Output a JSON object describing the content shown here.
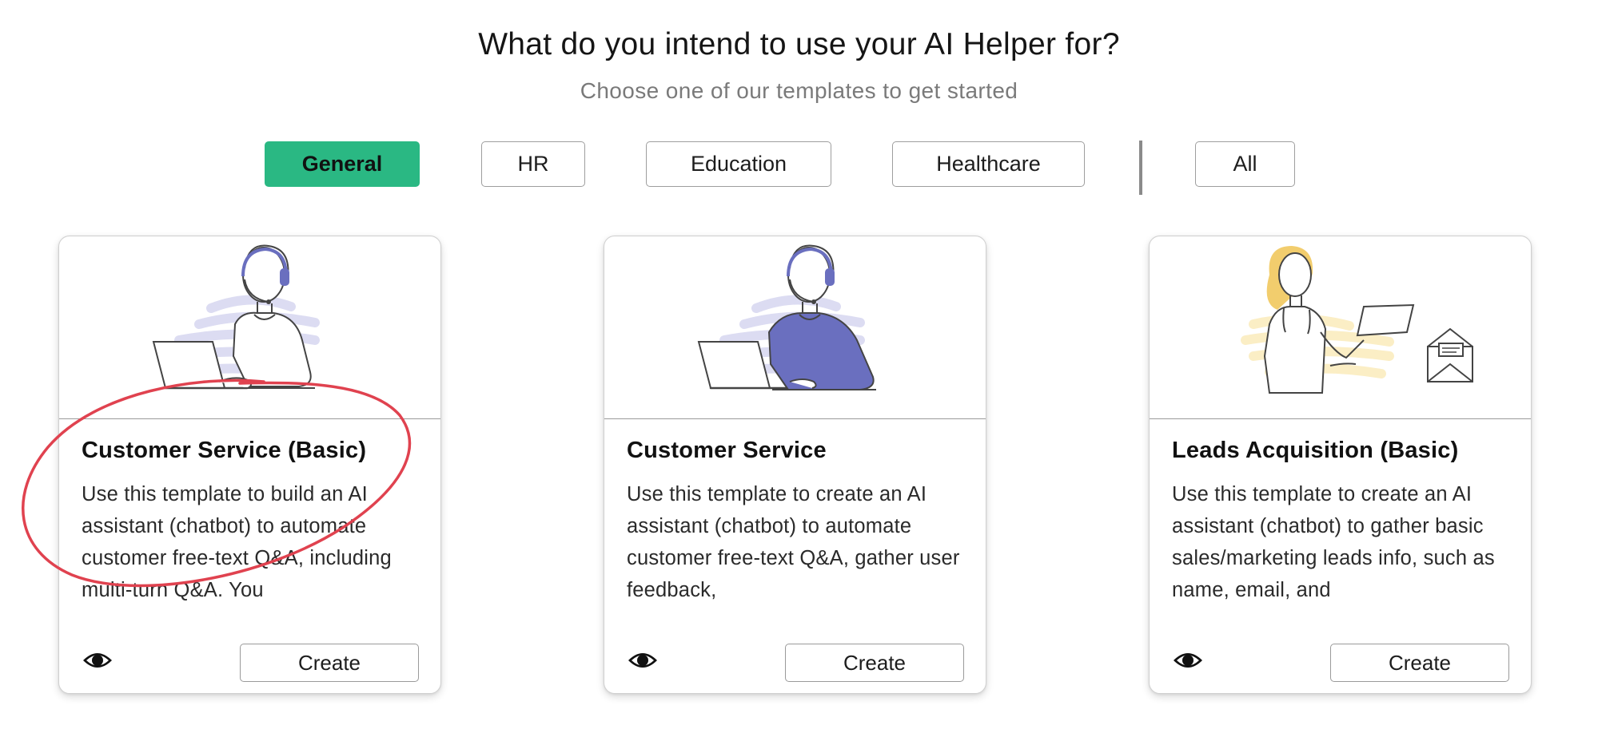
{
  "header": {
    "title": "What do you intend to use your AI Helper for?",
    "subtitle": "Choose one of our templates to get started"
  },
  "tabs": [
    {
      "label": "General",
      "active": true
    },
    {
      "label": "HR",
      "active": false
    },
    {
      "label": "Education",
      "active": false
    },
    {
      "label": "Healthcare",
      "active": false
    },
    {
      "label": "All",
      "active": false
    }
  ],
  "cards": [
    {
      "title": "Customer Service (Basic)",
      "description": "Use this template to build an AI assistant (chatbot) to automate customer free-text Q&A, including multi-turn Q&A. You",
      "illustration": "agent-with-headset-outline",
      "preview_icon": "eye-icon",
      "create_label": "Create"
    },
    {
      "title": "Customer Service",
      "description": "Use this template to create an AI assistant (chatbot) to automate customer free-text Q&A, gather user feedback,",
      "illustration": "agent-with-headset-purple-shirt",
      "preview_icon": "eye-icon",
      "create_label": "Create"
    },
    {
      "title": "Leads Acquisition (Basic)",
      "description": "Use this template to create an AI assistant (chatbot) to gather basic sales/marketing leads info, such as name, email, and",
      "illustration": "woman-with-tablet-and-envelope",
      "preview_icon": "eye-icon",
      "create_label": "Create"
    }
  ],
  "colors": {
    "accent": "#2ab883",
    "annotation": "#e0424f",
    "illustration_purple": "#6a6fbf",
    "illustration_yellow": "#f2cd6d"
  }
}
